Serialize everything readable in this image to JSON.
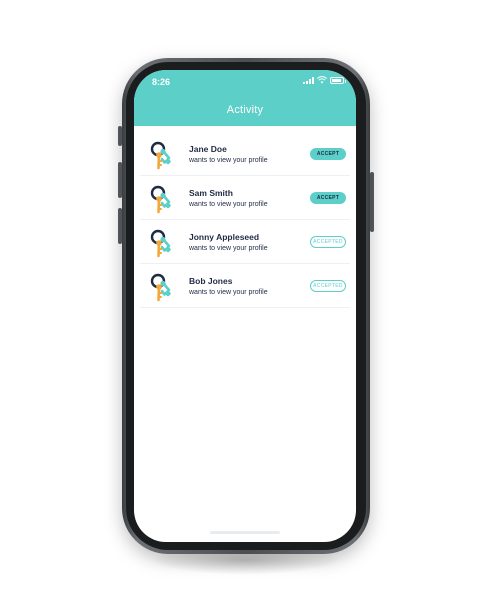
{
  "status_bar": {
    "time": "8:26"
  },
  "header": {
    "title": "Activity"
  },
  "colors": {
    "accent": "#5ccfc9",
    "text": "#1f2a44",
    "background": "#ffffff",
    "device": "#4b4f52"
  },
  "activity": {
    "items": [
      {
        "name": "Jane Doe",
        "message": "wants to view your profile",
        "action": "ACCEPT",
        "state": "pending",
        "icon": "keys-icon"
      },
      {
        "name": "Sam Smith",
        "message": "wants to view your profile",
        "action": "ACCEPT",
        "state": "pending",
        "icon": "keys-icon"
      },
      {
        "name": "Jonny Appleseed",
        "message": "wants to view your profile",
        "action": "ACCEPTED",
        "state": "accepted",
        "icon": "keys-icon"
      },
      {
        "name": "Bob Jones",
        "message": "wants to view your profile",
        "action": "ACCEPTED",
        "state": "accepted",
        "icon": "keys-icon"
      }
    ]
  }
}
